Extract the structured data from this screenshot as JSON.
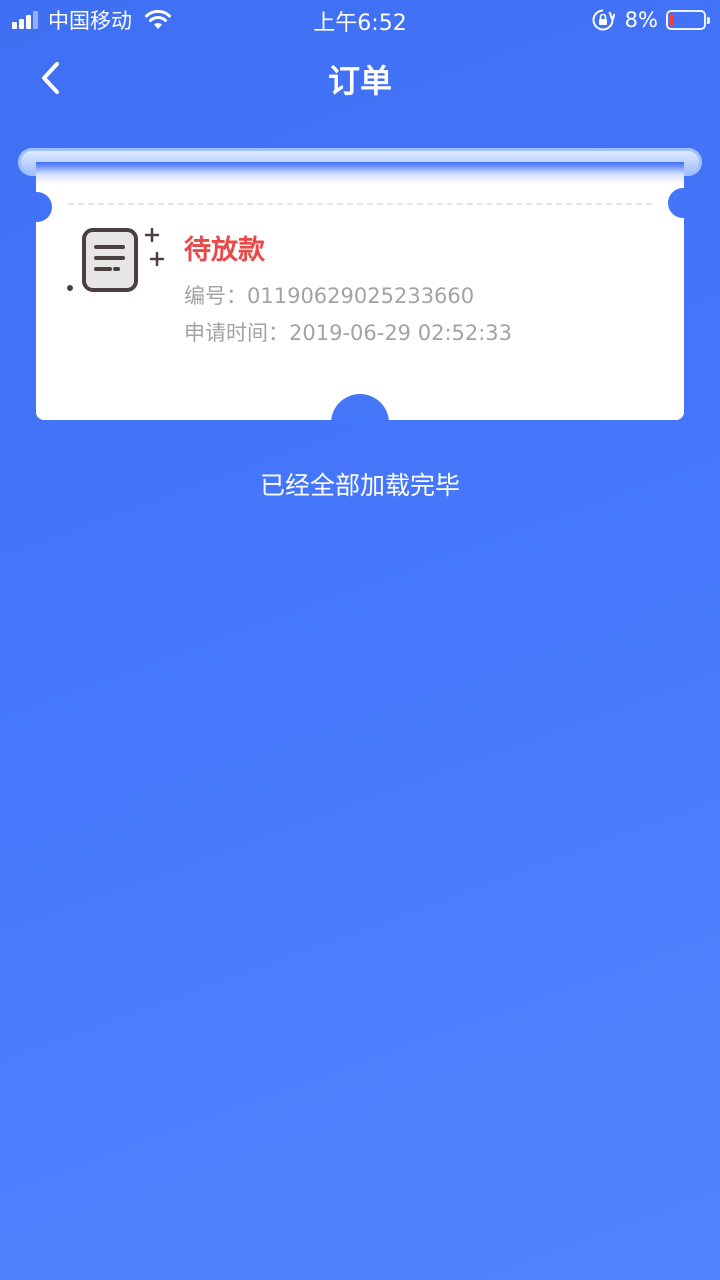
{
  "status_bar": {
    "carrier": "中国移动",
    "time": "上午6:52",
    "battery_percent": "8%",
    "battery_level": 0.08,
    "battery_color": "#ff3b30",
    "icons": [
      "signal-icon",
      "wifi-icon",
      "orientation-lock-icon",
      "battery-icon"
    ]
  },
  "navbar": {
    "title": "订单",
    "back_icon": "chevron-left-icon"
  },
  "orders": [
    {
      "status": "待放款",
      "status_color": "#e84a4a",
      "number_label": "编号：",
      "number": "01190629025233660",
      "time_label": "申请时间：",
      "time": "2019-06-29 02:52:33",
      "icon": "document-icon"
    }
  ],
  "footer": {
    "message": "已经全部加载完毕"
  }
}
